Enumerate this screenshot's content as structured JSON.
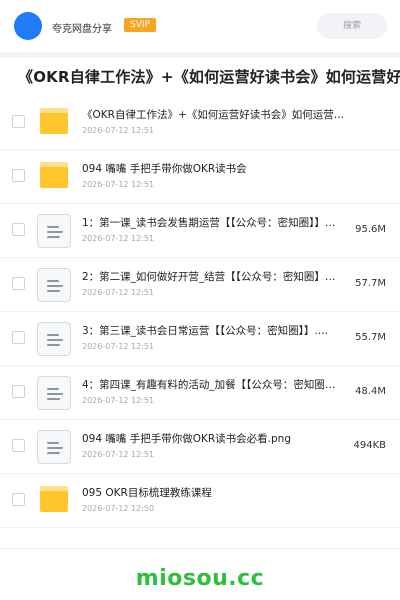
{
  "header": {
    "brand": "夸克网盘分享",
    "svip": "SVIP",
    "search_placeholder": "搜索"
  },
  "title": "《OKR自律工作法》+《如何运营好读书会》如何运营好赚",
  "items": [
    {
      "type": "folder",
      "name": "《OKR自律工作法》+《如何运营好读书会》如何运营…",
      "date": "2026-07-12 12:51",
      "size": ""
    },
    {
      "type": "folder",
      "name": "094 嘴嘴 手把手带你做OKR读书会",
      "date": "2026-07-12 12:51",
      "size": ""
    },
    {
      "type": "file",
      "name": "1：第一课_读书会发售期运营【【公众号：密知圈】】…",
      "date": "2026-07-12 12:51",
      "size": "95.6M"
    },
    {
      "type": "file",
      "name": "2：第二课_如何做好开营_结营【【公众号：密知圈】…",
      "date": "2026-07-12 12:51",
      "size": "57.7M"
    },
    {
      "type": "file",
      "name": "3：第三课_读书会日常运营【【公众号：密知圈】】.…",
      "date": "2026-07-12 12:51",
      "size": "55.7M"
    },
    {
      "type": "file",
      "name": "4：第四课_有趣有料的活动_加餐【【公众号：密知圈…",
      "date": "2026-07-12 12:51",
      "size": "48.4M"
    },
    {
      "type": "file",
      "name": "094 嘴嘴 手把手带你做OKR读书会必看.png",
      "date": "2026-07-12 12:51",
      "size": "494KB"
    },
    {
      "type": "folder",
      "name": "095 OKR目标梳理教练课程",
      "date": "2026-07-12 12:50",
      "size": ""
    }
  ],
  "watermark": "miosou.cc",
  "colors": {
    "accent": "#1f7cf6",
    "svip": "#f6a623",
    "folder": "#ffc72c",
    "watermark": "#2fbf3b"
  }
}
